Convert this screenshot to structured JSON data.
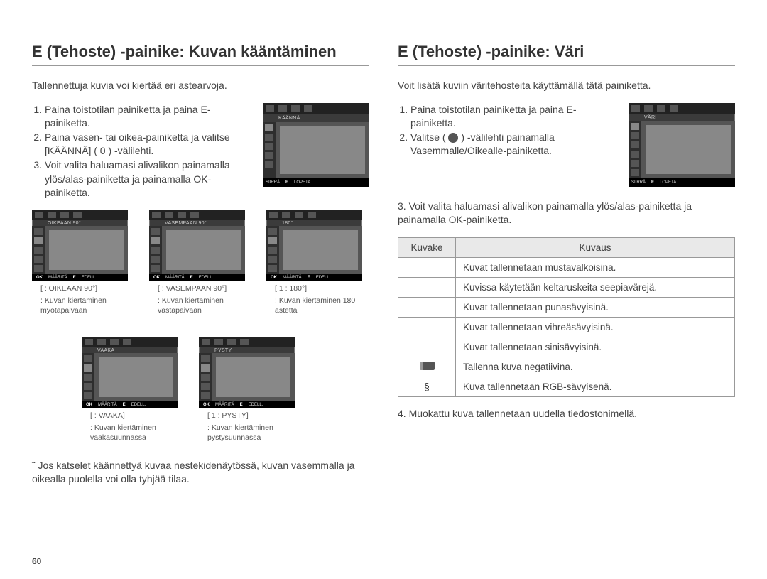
{
  "page_number": "60",
  "left": {
    "heading": "E (Tehoste) -painike: Kuvan kääntäminen",
    "intro": "Tallennettuja kuvia voi kiertää eri astearvoja.",
    "steps": [
      "Paina toistotilan painiketta ja paina E-painiketta.",
      "Paina vasen- tai oikea-painiketta ja valitse [KÄÄNNÄ] ( 0 ) -välilehti.",
      "Voit valita haluamasi alivalikon painamalla ylös/alas-painiketta ja painamalla OK-painiketta."
    ],
    "main_shot": {
      "title": "KÄÄNNÄ",
      "footer_l": "SIIRRÄ",
      "footer_r": "LOPETA",
      "footer_e": "E"
    },
    "thumbs": [
      {
        "shot_title": "OIKEAAN 90°",
        "footer_ok": "OK",
        "footer_mid": "MÄÄRITÄ",
        "footer_e": "E",
        "footer_r": "EDELL.",
        "cap1": "[  :  OIKEAAN  90°]",
        "cap2": ": Kuvan kiertäminen myötäpäivään"
      },
      {
        "shot_title": "VASEMPAAN 90°",
        "footer_ok": "OK",
        "footer_mid": "MÄÄRITÄ",
        "footer_e": "E",
        "footer_r": "EDELL.",
        "cap1": "[  :  VASEMPAAN 90°]",
        "cap2": ": Kuvan kiertäminen vastapäivään"
      },
      {
        "shot_title": "180°",
        "footer_ok": "OK",
        "footer_mid": "MÄÄRITÄ",
        "footer_e": "E",
        "footer_r": "EDELL.",
        "cap1": "[ 1 :  180°]",
        "cap2": ": Kuvan kiertäminen 180 astetta"
      },
      {
        "shot_title": "VAAKA",
        "footer_ok": "OK",
        "footer_mid": "MÄÄRITÄ",
        "footer_e": "E",
        "footer_r": "EDELL.",
        "cap1": "[  :  VAAKA]",
        "cap2": ": Kuvan kiertäminen vaakasuunnassa"
      },
      {
        "shot_title": "PYSTY",
        "footer_ok": "OK",
        "footer_mid": "MÄÄRITÄ",
        "footer_e": "E",
        "footer_r": "EDELL.",
        "cap1": "[ 1 :  PYSTY]",
        "cap2": ": Kuvan kiertäminen pystysuunnassa"
      }
    ],
    "note": "˜ Jos katselet käännettyä kuvaa nestekidenäytössä, kuvan vasemmalla ja oikealla puolella voi olla tyhjää tilaa."
  },
  "right": {
    "heading": "E (Tehoste) -painike: Väri",
    "intro": "Voit lisätä kuviin väritehosteita käyttämällä tätä painiketta.",
    "step1": "Paina toistotilan painiketta ja paina E-painiketta.",
    "step2a": "Valitse ( ",
    "step2b": " ) -välilehti painamalla Vasemmalle/Oikealle-painiketta.",
    "step3": "Voit valita haluamasi alivalikon painamalla ylös/alas-painiketta ja painamalla OK-painiketta.",
    "main_shot": {
      "title": "VÄRI",
      "footer_l": "SIIRRÄ",
      "footer_r": "LOPETA",
      "footer_e": "E"
    },
    "table": {
      "head_icon": "Kuvake",
      "head_desc": "Kuvaus",
      "rows": [
        {
          "icon": "",
          "desc": "Kuvat tallennetaan mustavalkoisina."
        },
        {
          "icon": "",
          "desc": "Kuvissa käytetään keltaruskeita seepiavärejä."
        },
        {
          "icon": "",
          "desc": "Kuvat tallennetaan punasävyisinä."
        },
        {
          "icon": "",
          "desc": "Kuvat tallennetaan vihreäsävyisinä."
        },
        {
          "icon": "",
          "desc": "Kuvat tallennetaan sinisävyisinä."
        },
        {
          "icon": "neg",
          "desc": "Tallenna kuva negatiivina."
        },
        {
          "icon": "§",
          "desc": "Kuva tallennetaan RGB-sävyisenä."
        }
      ]
    },
    "after": "4. Muokattu kuva tallennetaan uudella tiedostonimellä."
  }
}
